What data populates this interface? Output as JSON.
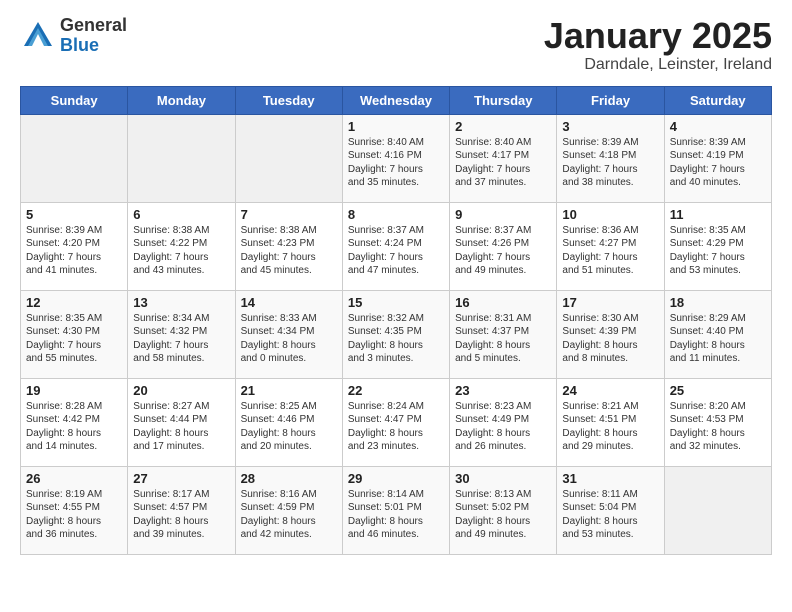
{
  "header": {
    "logo_general": "General",
    "logo_blue": "Blue",
    "title": "January 2025",
    "subtitle": "Darndale, Leinster, Ireland"
  },
  "days_of_week": [
    "Sunday",
    "Monday",
    "Tuesday",
    "Wednesday",
    "Thursday",
    "Friday",
    "Saturday"
  ],
  "weeks": [
    [
      {
        "num": "",
        "info": ""
      },
      {
        "num": "",
        "info": ""
      },
      {
        "num": "",
        "info": ""
      },
      {
        "num": "1",
        "info": "Sunrise: 8:40 AM\nSunset: 4:16 PM\nDaylight: 7 hours\nand 35 minutes."
      },
      {
        "num": "2",
        "info": "Sunrise: 8:40 AM\nSunset: 4:17 PM\nDaylight: 7 hours\nand 37 minutes."
      },
      {
        "num": "3",
        "info": "Sunrise: 8:39 AM\nSunset: 4:18 PM\nDaylight: 7 hours\nand 38 minutes."
      },
      {
        "num": "4",
        "info": "Sunrise: 8:39 AM\nSunset: 4:19 PM\nDaylight: 7 hours\nand 40 minutes."
      }
    ],
    [
      {
        "num": "5",
        "info": "Sunrise: 8:39 AM\nSunset: 4:20 PM\nDaylight: 7 hours\nand 41 minutes."
      },
      {
        "num": "6",
        "info": "Sunrise: 8:38 AM\nSunset: 4:22 PM\nDaylight: 7 hours\nand 43 minutes."
      },
      {
        "num": "7",
        "info": "Sunrise: 8:38 AM\nSunset: 4:23 PM\nDaylight: 7 hours\nand 45 minutes."
      },
      {
        "num": "8",
        "info": "Sunrise: 8:37 AM\nSunset: 4:24 PM\nDaylight: 7 hours\nand 47 minutes."
      },
      {
        "num": "9",
        "info": "Sunrise: 8:37 AM\nSunset: 4:26 PM\nDaylight: 7 hours\nand 49 minutes."
      },
      {
        "num": "10",
        "info": "Sunrise: 8:36 AM\nSunset: 4:27 PM\nDaylight: 7 hours\nand 51 minutes."
      },
      {
        "num": "11",
        "info": "Sunrise: 8:35 AM\nSunset: 4:29 PM\nDaylight: 7 hours\nand 53 minutes."
      }
    ],
    [
      {
        "num": "12",
        "info": "Sunrise: 8:35 AM\nSunset: 4:30 PM\nDaylight: 7 hours\nand 55 minutes."
      },
      {
        "num": "13",
        "info": "Sunrise: 8:34 AM\nSunset: 4:32 PM\nDaylight: 7 hours\nand 58 minutes."
      },
      {
        "num": "14",
        "info": "Sunrise: 8:33 AM\nSunset: 4:34 PM\nDaylight: 8 hours\nand 0 minutes."
      },
      {
        "num": "15",
        "info": "Sunrise: 8:32 AM\nSunset: 4:35 PM\nDaylight: 8 hours\nand 3 minutes."
      },
      {
        "num": "16",
        "info": "Sunrise: 8:31 AM\nSunset: 4:37 PM\nDaylight: 8 hours\nand 5 minutes."
      },
      {
        "num": "17",
        "info": "Sunrise: 8:30 AM\nSunset: 4:39 PM\nDaylight: 8 hours\nand 8 minutes."
      },
      {
        "num": "18",
        "info": "Sunrise: 8:29 AM\nSunset: 4:40 PM\nDaylight: 8 hours\nand 11 minutes."
      }
    ],
    [
      {
        "num": "19",
        "info": "Sunrise: 8:28 AM\nSunset: 4:42 PM\nDaylight: 8 hours\nand 14 minutes."
      },
      {
        "num": "20",
        "info": "Sunrise: 8:27 AM\nSunset: 4:44 PM\nDaylight: 8 hours\nand 17 minutes."
      },
      {
        "num": "21",
        "info": "Sunrise: 8:25 AM\nSunset: 4:46 PM\nDaylight: 8 hours\nand 20 minutes."
      },
      {
        "num": "22",
        "info": "Sunrise: 8:24 AM\nSunset: 4:47 PM\nDaylight: 8 hours\nand 23 minutes."
      },
      {
        "num": "23",
        "info": "Sunrise: 8:23 AM\nSunset: 4:49 PM\nDaylight: 8 hours\nand 26 minutes."
      },
      {
        "num": "24",
        "info": "Sunrise: 8:21 AM\nSunset: 4:51 PM\nDaylight: 8 hours\nand 29 minutes."
      },
      {
        "num": "25",
        "info": "Sunrise: 8:20 AM\nSunset: 4:53 PM\nDaylight: 8 hours\nand 32 minutes."
      }
    ],
    [
      {
        "num": "26",
        "info": "Sunrise: 8:19 AM\nSunset: 4:55 PM\nDaylight: 8 hours\nand 36 minutes."
      },
      {
        "num": "27",
        "info": "Sunrise: 8:17 AM\nSunset: 4:57 PM\nDaylight: 8 hours\nand 39 minutes."
      },
      {
        "num": "28",
        "info": "Sunrise: 8:16 AM\nSunset: 4:59 PM\nDaylight: 8 hours\nand 42 minutes."
      },
      {
        "num": "29",
        "info": "Sunrise: 8:14 AM\nSunset: 5:01 PM\nDaylight: 8 hours\nand 46 minutes."
      },
      {
        "num": "30",
        "info": "Sunrise: 8:13 AM\nSunset: 5:02 PM\nDaylight: 8 hours\nand 49 minutes."
      },
      {
        "num": "31",
        "info": "Sunrise: 8:11 AM\nSunset: 5:04 PM\nDaylight: 8 hours\nand 53 minutes."
      },
      {
        "num": "",
        "info": ""
      }
    ]
  ]
}
